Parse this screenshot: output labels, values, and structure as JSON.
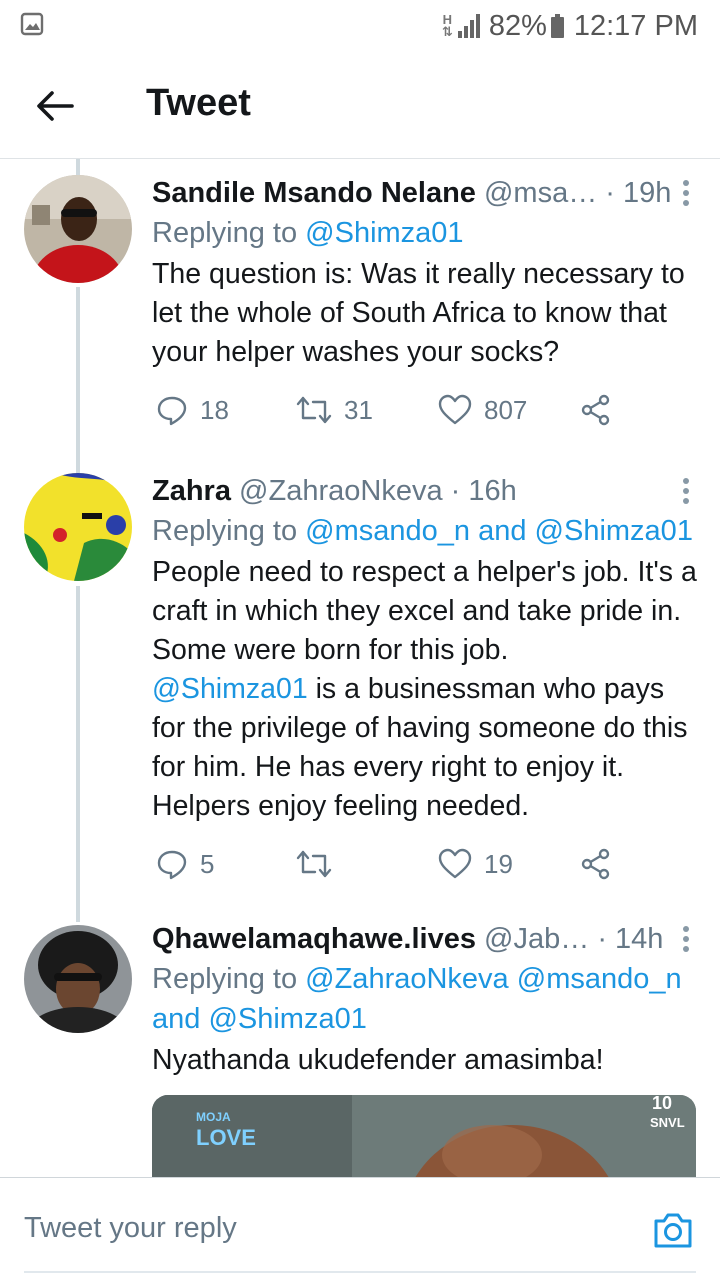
{
  "status_bar": {
    "network_type": "H",
    "battery": "82%",
    "time": "12:17 PM"
  },
  "app_bar": {
    "title": "Tweet",
    "icons": {
      "back": "arrow-left-icon"
    }
  },
  "tweets": [
    {
      "name": "Sandile Msando Nelane",
      "handle": "@msa…",
      "dot": "·",
      "time": "19h",
      "replying_prefix": "Replying to",
      "replying_to": [
        "@Shimza01"
      ],
      "text": "The question is: Was it really necessary to let the whole of South Africa to know that your helper washes your socks?",
      "replies": "18",
      "retweets": "31",
      "likes": "807"
    },
    {
      "name": "Zahra",
      "handle": "@ZahraoNkeva",
      "dot": "·",
      "time": "16h",
      "replying_prefix": "Replying to",
      "replying_to": [
        "@msando_n",
        "@Shimza01"
      ],
      "replying_joiner": "and",
      "text_mention": "@Shimza01",
      "text_part1": "People need to respect a helper's job. It's a craft in which they excel and take pride in. Some were born for this job.",
      "text_part2": " is a businessman who pays for the privilege of having someone do this for him. He has every right to enjoy it. Helpers enjoy feeling needed.",
      "replies": "5",
      "retweets": "",
      "likes": "19"
    },
    {
      "name": "Qhawelamaqhawe.lives",
      "handle": "@Jab…",
      "dot": "·",
      "time": "14h",
      "replying_prefix": "Replying to",
      "replying_to": [
        "@ZahraoNkeva",
        "@msando_n",
        "@Shimza01"
      ],
      "replying_joiner": "and",
      "text": "Nyathanda ukudefender amasimba!",
      "media_labels": {
        "left_top": "MOJA",
        "left_bottom": "LOVE",
        "right_top": "10",
        "right_bottom": "SNVL"
      }
    }
  ],
  "composer": {
    "placeholder": "Tweet your reply",
    "icons": {
      "camera": "camera-icon"
    }
  },
  "colors": {
    "accent": "#1b95e0",
    "text_primary": "#14171a",
    "text_secondary": "#657786",
    "divider": "#dfe3e6",
    "thread_line": "#cfd9de"
  }
}
